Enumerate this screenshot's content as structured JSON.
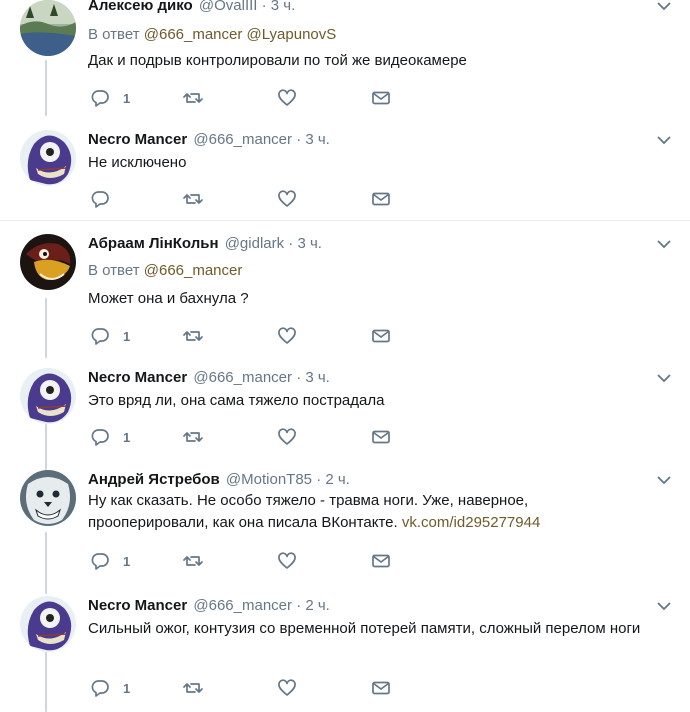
{
  "icons": {
    "reply": "reply-icon",
    "retweet": "retweet-icon",
    "like": "heart-icon",
    "message": "envelope-icon",
    "more": "chevron-down-icon"
  },
  "colors": {
    "icon": "#657786",
    "link": "#6f5a2a",
    "thread_line": "#ccd6dd",
    "divider": "#e6ecf0"
  },
  "tweets": [
    {
      "name": "Алексею дико",
      "handle": "@OvalIII",
      "dot": "·",
      "time": "3 ч.",
      "reply_prefix": "В ответ",
      "reply_to": [
        "@666_mancer",
        "@LyapunovS"
      ],
      "text": "Дак и подрыв контролировали по той же видеокамере",
      "reply_count": "1"
    },
    {
      "name": "Necro Mancer",
      "handle": "@666_mancer",
      "dot": "·",
      "time": "3 ч.",
      "text": "Не исключено",
      "reply_count": ""
    },
    {
      "name": "Абраам ЛінКольн",
      "handle": "@gidlark",
      "dot": "·",
      "time": "3 ч.",
      "reply_prefix": "В ответ",
      "reply_to": [
        "@666_mancer"
      ],
      "text": "Может она и бахнула ?",
      "reply_count": "1"
    },
    {
      "name": "Necro Mancer",
      "handle": "@666_mancer",
      "dot": "·",
      "time": "3 ч.",
      "text": "Это вряд ли, она сама тяжело пострадала",
      "reply_count": "1"
    },
    {
      "name": "Андрей Ястребов",
      "handle": "@MotionT85",
      "dot": "·",
      "time": "2 ч.",
      "text": "Ну как сказать. Не особо тяжело - травма ноги. Уже, наверное, прооперировали, как она писала ВКонтакте.",
      "link": "vk.com/id295277944",
      "reply_count": "1"
    },
    {
      "name": "Necro Mancer",
      "handle": "@666_mancer",
      "dot": "·",
      "time": "2 ч.",
      "text": "Сильный ожог, контузия со временной потерей памяти, сложный перелом ноги",
      "reply_count": "1"
    }
  ]
}
